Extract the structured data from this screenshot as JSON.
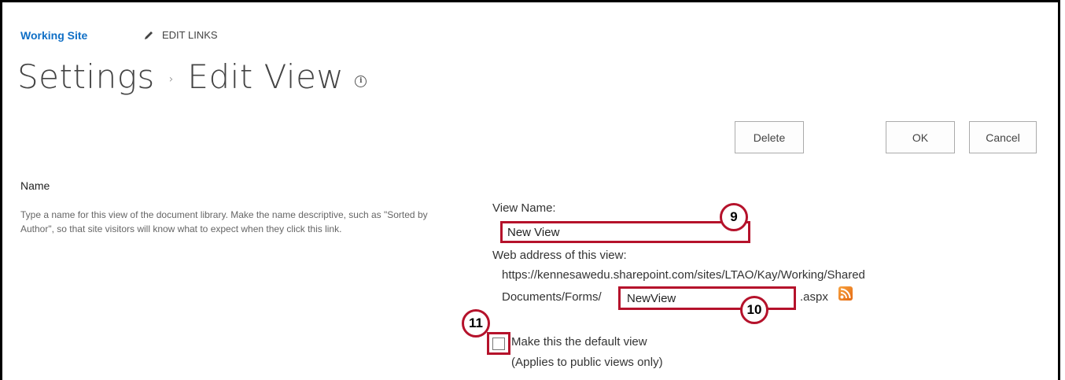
{
  "header": {
    "site_name": "Working Site",
    "edit_links_label": "EDIT LINKS"
  },
  "title": {
    "part1": "Settings",
    "separator": "›",
    "part2": "Edit View",
    "info_icon_glyph": "i"
  },
  "toolbar": {
    "delete_label": "Delete",
    "ok_label": "OK",
    "cancel_label": "Cancel"
  },
  "name_section": {
    "title": "Name",
    "description": "Type a name for this view of the document library. Make the name descriptive, such as \"Sorted by Author\", so that site visitors will know what to expect when they click this link.",
    "view_name_label": "View Name:",
    "view_name_value": "New View",
    "web_address_label": "Web address of this view:",
    "url_line1": "https://kennesawedu.sharepoint.com/sites/LTAO/Kay/Working/Shared",
    "url_prefix": "Documents/Forms/",
    "address_value": "NewView",
    "url_suffix": ".aspx",
    "rss_icon": "rss-feed-icon",
    "default_view_label": "Make this the default view",
    "default_view_note": "(Applies to public views only)",
    "default_view_checked": false
  },
  "callouts": {
    "c9": "9",
    "c10": "10",
    "c11": "11"
  },
  "colors": {
    "link_blue": "#0f6fc6",
    "highlight_red": "#b5122b",
    "rss_orange": "#f7a240"
  }
}
